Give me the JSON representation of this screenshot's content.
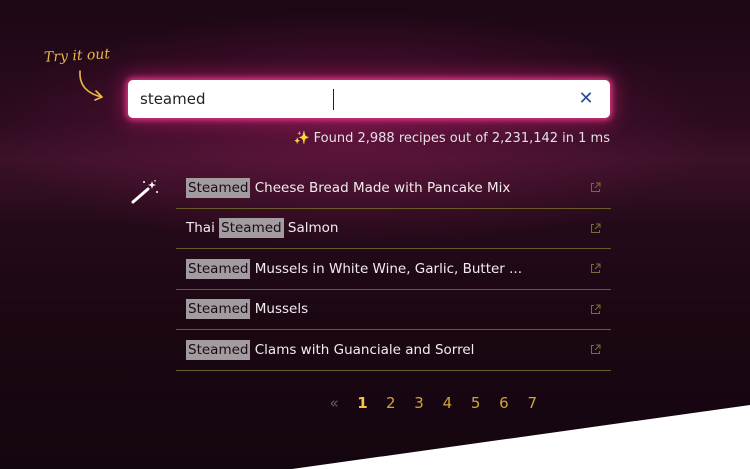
{
  "hint": {
    "label": "Try it out"
  },
  "search": {
    "value": "steamed",
    "clear_icon": "close-icon"
  },
  "stats": {
    "sparkle": "✨",
    "text": "Found 2,988 recipes out of 2,231,142 in 1 ms"
  },
  "results": [
    {
      "before": "",
      "highlight": "Steamed",
      "after": " Cheese Bread Made with Pancake Mix"
    },
    {
      "before": "Thai ",
      "highlight": "Steamed",
      "after": " Salmon"
    },
    {
      "before": "",
      "highlight": "Steamed",
      "after": " Mussels in White Wine, Garlic, Butter ..."
    },
    {
      "before": "",
      "highlight": "Steamed",
      "after": " Mussels"
    },
    {
      "before": "",
      "highlight": "Steamed",
      "after": " Clams with Guanciale and Sorrel"
    }
  ],
  "pagination": {
    "prev": "«",
    "pages": [
      "1",
      "2",
      "3",
      "4",
      "5",
      "6",
      "7"
    ],
    "current": "1"
  },
  "colors": {
    "accent": "#f4c24a",
    "highlight_bg": "#a29ba0",
    "glow": "#e0307f",
    "clear_icon": "#2b4e9b"
  }
}
